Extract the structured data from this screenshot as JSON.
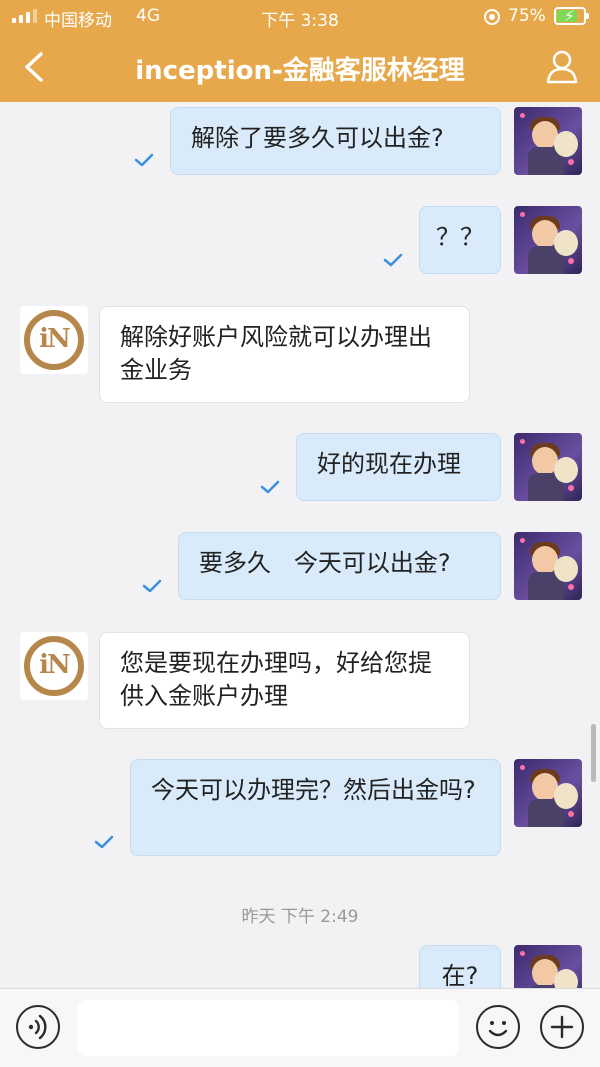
{
  "status_bar": {
    "carrier": "中国移动",
    "network": "4G",
    "time": "下午 3:38",
    "battery": "75%",
    "battery_level": 0.75,
    "charging": true
  },
  "header": {
    "back_icon": "chevron-left-icon",
    "title": "inception-金融客服林经理",
    "profile_icon": "person-icon"
  },
  "messages": [
    {
      "sender": "me",
      "text": "解除了要多久可以出金?",
      "read": true
    },
    {
      "sender": "me",
      "text": "？？",
      "read": true
    },
    {
      "sender": "agent",
      "text": "解除好账户风险就可以办理出金业务"
    },
    {
      "sender": "me",
      "text": "好的现在办理",
      "read": true
    },
    {
      "sender": "me",
      "text": "要多久   今天可以出金?",
      "read": true
    },
    {
      "sender": "agent",
      "text": "您是要现在办理吗，好给您提供入金账户办理"
    },
    {
      "sender": "me",
      "text": "今天可以办理完？然后出金吗?",
      "read": true
    },
    {
      "sender": "me",
      "text": "在?",
      "read": false
    }
  ],
  "timestamp": "昨天 下午 2:49",
  "agent_avatar_letters": "iN",
  "input_bar": {
    "voice_icon": "voice-icon",
    "input_value": "",
    "emoji_icon": "smiley-icon",
    "plus_icon": "plus-icon"
  },
  "colors": {
    "header": "#e6a84b",
    "my_bubble": "#d9ebfa",
    "agent_bubble": "#ffffff",
    "read_check": "#3d8fe0"
  }
}
